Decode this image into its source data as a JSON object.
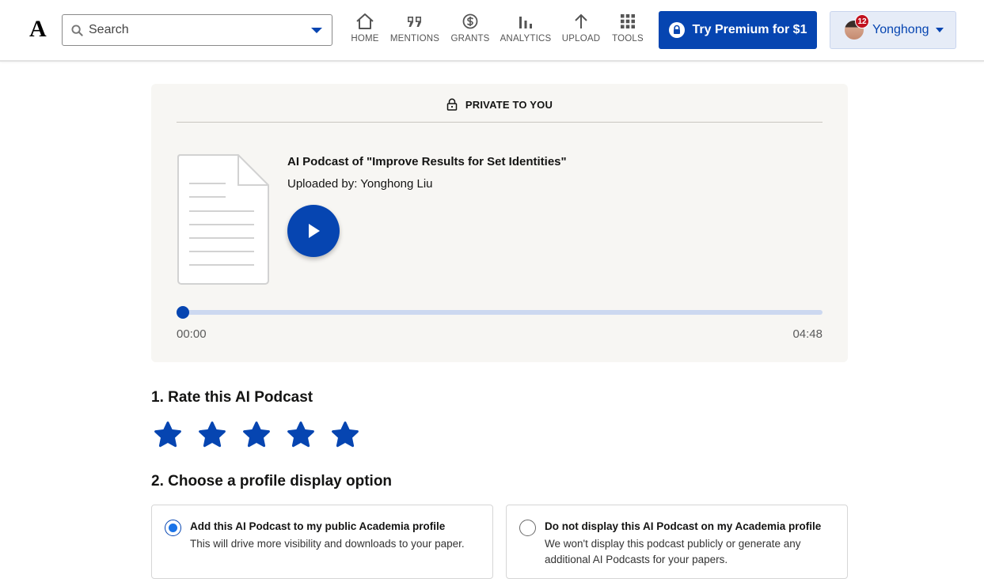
{
  "nav": {
    "logo": "A",
    "search_placeholder": "Search",
    "items": [
      {
        "label": "HOME",
        "icon": "home-icon"
      },
      {
        "label": "MENTIONS",
        "icon": "quote-icon"
      },
      {
        "label": "GRANTS",
        "icon": "dollar-icon"
      },
      {
        "label": "ANALYTICS",
        "icon": "bar-chart-icon"
      },
      {
        "label": "UPLOAD",
        "icon": "arrow-up-icon"
      },
      {
        "label": "TOOLS",
        "icon": "grid-icon"
      }
    ],
    "premium_label": "Try Premium for $1",
    "user_name": "Yonghong",
    "notification_count": "12"
  },
  "player": {
    "privacy_label": "PRIVATE TO YOU",
    "title": "AI Podcast of \"Improve Results for Set Identities\"",
    "uploader": "Uploaded by: Yonghong Liu",
    "time_current": "00:00",
    "time_total": "04:48",
    "progress": 0
  },
  "rating": {
    "heading": "1. Rate this AI Podcast",
    "max_stars": 5
  },
  "display": {
    "heading": "2. Choose a profile display option",
    "options": [
      {
        "title": "Add this AI Podcast to my public Academia profile",
        "description": "This will drive more visibility and downloads to your paper.",
        "selected": true
      },
      {
        "title": "Do not display this AI Podcast on my Academia profile",
        "description": "We won't display this podcast publicly or generate any additional AI Podcasts for your papers.",
        "selected": false
      }
    ]
  },
  "colors": {
    "brand_blue": "#0645b1",
    "card_bg": "#f7f6f3",
    "badge_red": "#c1121f"
  }
}
